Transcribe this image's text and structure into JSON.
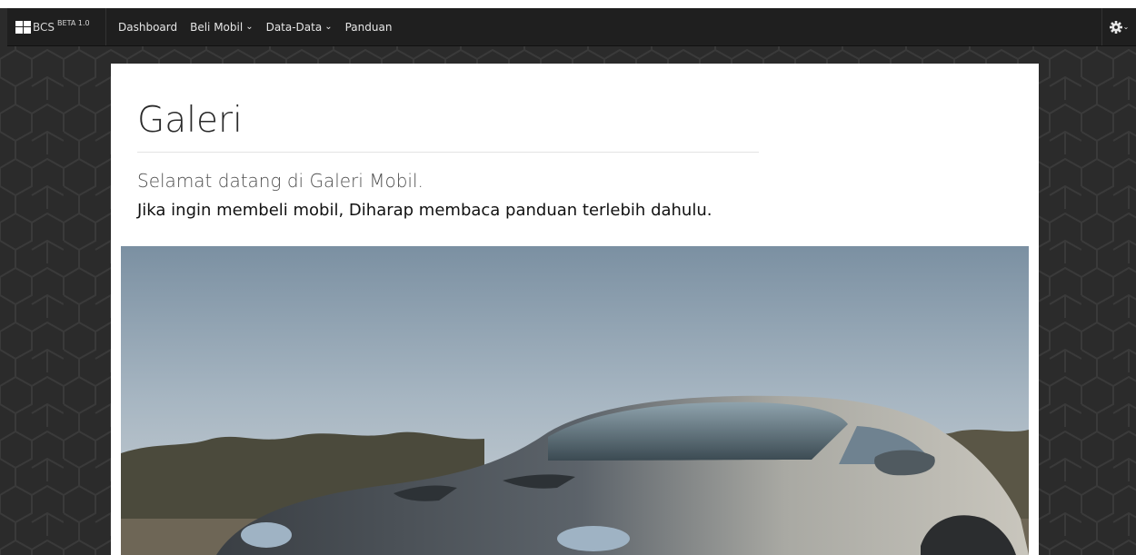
{
  "brand": {
    "name": "BCS",
    "version": "BETA 1.0",
    "icon": "grid-logo-icon"
  },
  "nav": {
    "items": [
      {
        "label": "Dashboard",
        "dropdown": false
      },
      {
        "label": "Beli Mobil",
        "dropdown": true
      },
      {
        "label": "Data-Data",
        "dropdown": true
      },
      {
        "label": "Panduan",
        "dropdown": false
      }
    ],
    "settings_icon": "gear-icon"
  },
  "page": {
    "title": "Galeri",
    "lead": "Selamat datang di Galeri Mobil.",
    "sub": "Jika ingin membeli mobil, Diharap membaca panduan terlebih dahulu."
  },
  "hero_image": {
    "subject": "silver sports car"
  },
  "colors": {
    "navbar": "#1f1f1f",
    "background": "#2b2b2b",
    "card": "#ffffff"
  }
}
